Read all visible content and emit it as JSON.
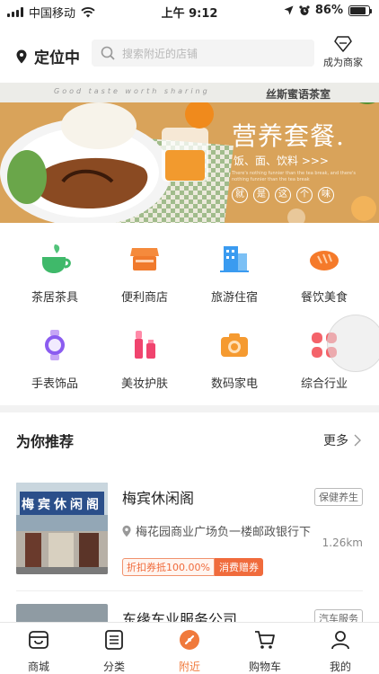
{
  "status_bar": {
    "carrier": "中国移动",
    "time": "上午 9:12",
    "battery": "86%",
    "battery_level": 0.86
  },
  "header": {
    "location_label": "定位中",
    "search_placeholder": "搜索附近的店铺",
    "merchant_label": "成为商家"
  },
  "banner": {
    "tagline": "Good taste worth sharing",
    "shop_name": "丝斯蜜语茶室",
    "title": "营养套餐.",
    "subtitle": "饭、面、饮料 >>>",
    "fine_print": "There's nothing funnier than the tea break, and there's nothing funnier than the tea break",
    "bubbles": [
      "就",
      "是",
      "这",
      "个",
      "味"
    ]
  },
  "categories": [
    {
      "label": "茶居茶具",
      "icon": "tea-cup-icon"
    },
    {
      "label": "便利商店",
      "icon": "store-icon"
    },
    {
      "label": "旅游住宿",
      "icon": "building-icon"
    },
    {
      "label": "餐饮美食",
      "icon": "bread-icon"
    },
    {
      "label": "手表饰品",
      "icon": "watch-icon"
    },
    {
      "label": "美妆护肤",
      "icon": "cosmetics-icon"
    },
    {
      "label": "数码家电",
      "icon": "camera-icon"
    },
    {
      "label": "综合行业",
      "icon": "grid-icon"
    }
  ],
  "recommend": {
    "title": "为你推荐",
    "more": "更多",
    "items": [
      {
        "name": "梅宾休闲阁",
        "tag": "保健养生",
        "address": "梅花园商业广场负一楼邮政银行下",
        "distance": "1.26km",
        "coupon_text": "折扣券抵100.00%",
        "coupon_badge": "消费赠券",
        "sign_text": "梅宾休闲阁"
      },
      {
        "name": "东缘车业服务公司",
        "tag": "汽车服务"
      }
    ]
  },
  "tabbar": {
    "items": [
      {
        "label": "商城",
        "icon": "mall-icon",
        "active": false
      },
      {
        "label": "分类",
        "icon": "list-icon",
        "active": false
      },
      {
        "label": "附近",
        "icon": "nearby-icon",
        "active": true
      },
      {
        "label": "购物车",
        "icon": "cart-icon",
        "active": false
      },
      {
        "label": "我的",
        "icon": "profile-icon",
        "active": false
      }
    ]
  },
  "colors": {
    "accent": "#f07a3c",
    "banner_bg": "#d9a35a"
  }
}
